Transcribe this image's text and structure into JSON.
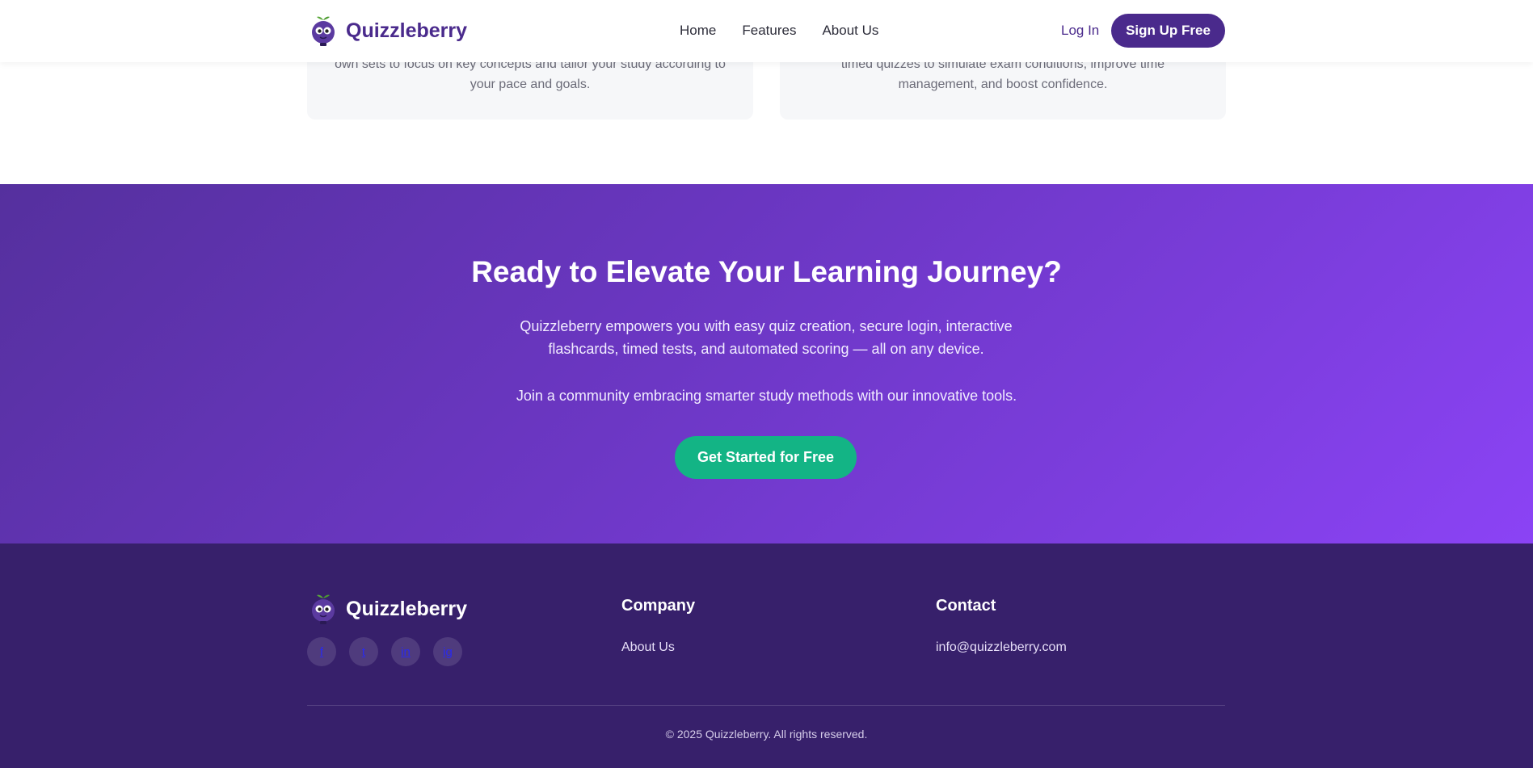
{
  "header": {
    "brand": "Quizzleberry",
    "nav": [
      "Home",
      "Features",
      "About Us"
    ],
    "login_label": "Log In",
    "signup_label": "Sign Up Free"
  },
  "features": {
    "card1_text": "own sets to focus on key concepts and tailor your study according to your pace and goals.",
    "card2_text": "timed quizzes to simulate exam conditions, improve time management, and boost confidence."
  },
  "cta": {
    "title": "Ready to Elevate Your Learning Journey?",
    "description": "Quizzleberry empowers you with easy quiz creation, secure login, interactive flashcards, timed tests, and automated scoring — all on any device.",
    "join": "Join a community embracing smarter study methods with our innovative tools.",
    "button_label": "Get Started for Free"
  },
  "footer": {
    "brand": "Quizzleberry",
    "socials": [
      "f",
      "t",
      "in",
      "ig"
    ],
    "company_title": "Company",
    "company_link": "About Us",
    "contact_title": "Contact",
    "contact_email": "info@quizzleberry.com",
    "copyright": "© 2025 Quizzleberry. All rights reserved."
  },
  "colors": {
    "brand_purple": "#4a2a8c",
    "cta_gradient_start": "#55309e",
    "cta_gradient_end": "#8b43f5",
    "cta_button": "#13b485",
    "footer_bg": "#37206b"
  }
}
